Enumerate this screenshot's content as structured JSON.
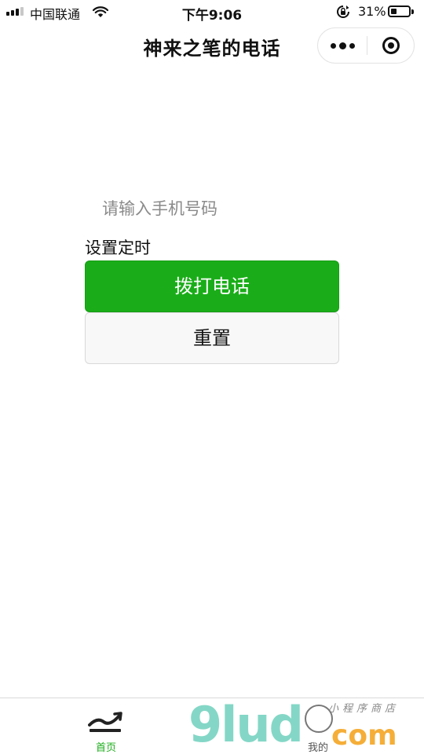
{
  "status_bar": {
    "carrier": "中国联通",
    "time": "下午9:06",
    "battery_percent": "31%",
    "battery_level": 0.31,
    "signal_bars_filled": 3,
    "signal_bars_total": 4
  },
  "nav": {
    "title": "神来之笔的电话"
  },
  "form": {
    "phone_placeholder": "请输入手机号码",
    "phone_value": "",
    "timer_label": "设置定时",
    "call_button": "拨打电话",
    "reset_button": "重置"
  },
  "tabbar": {
    "home_label": "首页",
    "mine_label": "我的",
    "active": "home",
    "active_color": "#1aad19"
  },
  "watermark": {
    "text_9lud": "9lud",
    "text_com": "com",
    "text_store": "小程序商店"
  },
  "colors": {
    "primary": "#1aad19",
    "secondary_bg": "#f8f8f8",
    "placeholder": "#8a8a8a"
  }
}
